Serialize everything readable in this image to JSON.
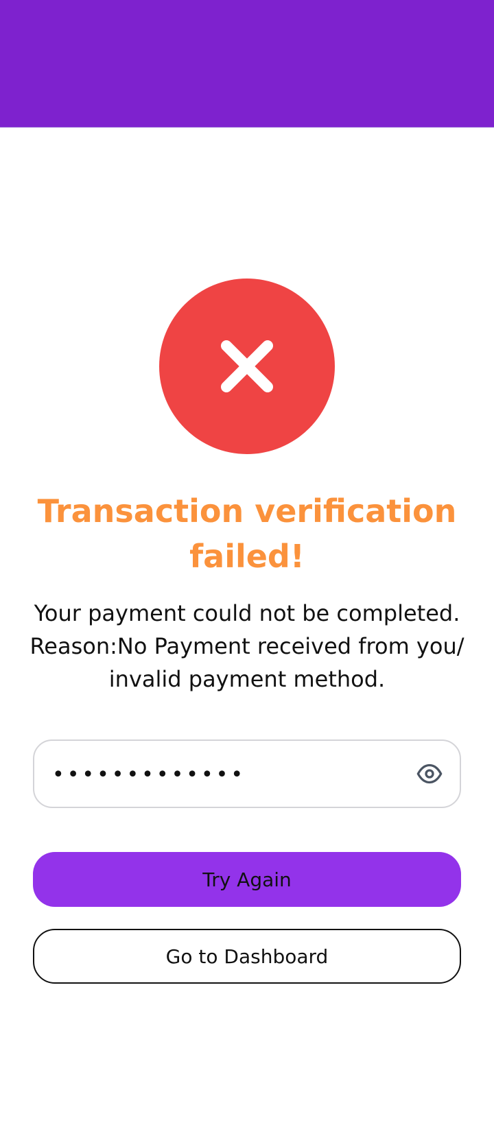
{
  "header": {
    "background_color": "#7e22ce"
  },
  "status": {
    "icon": "close-icon",
    "circle_color": "#ef4444",
    "icon_color": "#ffffff"
  },
  "title": {
    "text": "Transaction verification failed!",
    "color": "#fb923c"
  },
  "message": {
    "line1": "Your payment could not be completed.",
    "line2": "Reason:No Payment received from you/",
    "line3": "invalid payment method."
  },
  "password_field": {
    "value": "•••••••••••••",
    "toggle_icon": "eye-icon"
  },
  "buttons": {
    "try_again_label": "Try Again",
    "try_again_color": "#9333ea",
    "dashboard_label": "Go to Dashboard"
  }
}
